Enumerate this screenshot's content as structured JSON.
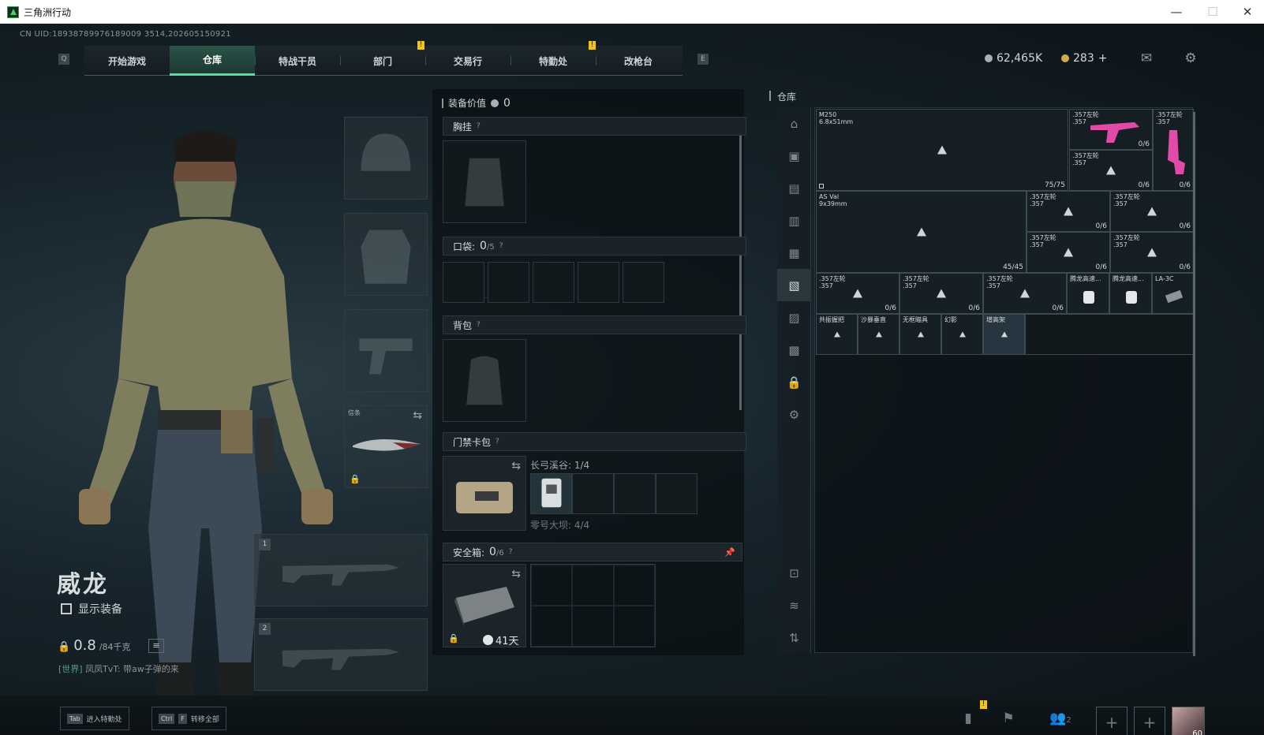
{
  "window": {
    "title": "三角洲行动"
  },
  "uid": "CN UID:18938789976189009 3514,202605150921",
  "nav": {
    "left_key": "Q",
    "right_key": "E",
    "tabs": [
      "开始游戏",
      "仓库",
      "特战干员",
      "部门",
      "交易行",
      "特勤处",
      "改枪台"
    ],
    "active": "仓库",
    "notif": "!"
  },
  "currency": {
    "silver": "62,465K",
    "gold": "283",
    "plus": "+"
  },
  "character": {
    "name": "威龙",
    "show_gear": "显示装备",
    "weight": "0.8",
    "weight_cap": "/84千克"
  },
  "chat": {
    "channel": "[世界]",
    "user": "凤凤TvT:",
    "message": "带aw子弹的来"
  },
  "loadout": {
    "melee_label": "信条",
    "slot1": "1",
    "slot2": "2"
  },
  "equipment": {
    "value_label": "装备价值",
    "value": "0",
    "chest": "胸挂",
    "pockets": "口袋:",
    "pockets_count": "0",
    "pockets_cap": "/5",
    "backpack": "背包",
    "keycard": "门禁卡包",
    "keycard_line1": "长弓溪谷: 1/4",
    "keycard_line2": "零号大坝: 4/4",
    "safe": "安全箱:",
    "safe_count": "0",
    "safe_cap": "/6",
    "safe_timer": "41天",
    "help": "?"
  },
  "stash": {
    "title": "仓库",
    "items": [
      {
        "name": "M250\n6.8x51mm",
        "count": "75/75"
      },
      {
        "name": ".357左轮\n.357",
        "count": "0/6"
      },
      {
        "name": ".357左轮\n.357",
        "count": ""
      },
      {
        "name": ".357左轮\n.357",
        "count": "0/6"
      },
      {
        "name": "AS Val\n9x39mm",
        "count": "45/45"
      },
      {
        "name": ".357左轮\n.357",
        "count": "0/6"
      },
      {
        "name": ".357左轮\n.357",
        "count": "0/6"
      },
      {
        "name": ".357左轮\n.357",
        "count": "0/6"
      },
      {
        "name": ".357左轮\n.357",
        "count": "0/6"
      },
      {
        "name": ".357左轮\n.357",
        "count": "0/6"
      },
      {
        "name": ".357左轮\n.357",
        "count": "0/6"
      },
      {
        "name": ".357左轮\n.357",
        "count": "0/6"
      },
      {
        "name": "腾龙高速...",
        "count": ""
      },
      {
        "name": "腾龙高速...",
        "count": ""
      },
      {
        "name": "LA-3C",
        "count": ""
      },
      {
        "name": "共振握把",
        "count": ""
      },
      {
        "name": "沙暴垂直",
        "count": ""
      },
      {
        "name": "无框瞄具",
        "count": ""
      },
      {
        "name": "幻影",
        "count": ""
      },
      {
        "name": "增高架",
        "count": ""
      }
    ]
  },
  "bottom": {
    "tab_key": "Tab",
    "tab_label": "进入特勤处",
    "ctrl_key": "Ctrl",
    "f_key": "F",
    "transfer_label": "转移全部",
    "friends_count": "2",
    "level": "60"
  }
}
